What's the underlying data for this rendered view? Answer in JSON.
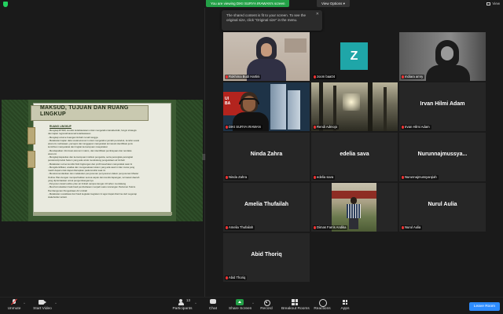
{
  "banner": {
    "viewing": "You are viewing DIKI SURYA IRAWAN's screen",
    "view_options": "View Options ▾",
    "view": "View"
  },
  "tooltip": {
    "text": "The shared content is fit to your screen. To see the original size, click \"Original size\" in the menu.",
    "close": "✕"
  },
  "slide": {
    "title": "MAKSUD, TUJUAN DAN RUANG LINGKUP",
    "subtitle": "RUANG LINGKUP",
    "lines": [
      "- Mengkaji RTRW, kondisi kota/kawasan untuk mengetahui karakteristik, fungsi strategis",
      "  dan kajian regional/nasional kota/kawasan",
      "- Mengkaji volume buangan limbah rumah tangga",
      "- Melakukan kajian data sosial-ekonomi untuk mengetahui jumlah penduduk, kondisi sosial",
      "  ekonomi, kebiasaan, persepsi dan tanggapan masyarakat termasuk  identifikasi  jenis",
      "  kontribusi  masyarakat dan tingkat kemampuan masyarakat",
      "- Mendapatkan informasi ekonomi makro, dan identifikasi pembiayaan dan tendaka",
      "  ekonomi",
      "- Mengkaji kapasitas dan kemampuan institusi pengelola, serta perangkat-perangkat",
      "  peraturan/produk hukum yang ada untuk mendukung pengelolaan air limbah",
      "- Melakukan survei kondisi fisik lingkungan dan profil kesehatan masyarakat saat ini",
      "- Mengidentifikasi, analisa dan mengevaluasi sistem yang ada saat ini  dan  mana  yang",
      "  masih  dapat  untuk  dapat  diterapkan  pada  kondisi  saat ini",
      "- Merekomendasikan dan melakukan penyusunan penyusunan dalam penyusunan Master",
      "  Outline Plan dengan memperhatikan semua aspek dan kondisi lapangan, termasuk daerah",
      "  yang diprioritaskan untuk pengembangannya",
      "- Penyusun detail outline plan air limbah sampai dengan  10  tahun mendatang",
      "- Memformulasikan hasil-hasil pembahasan menjadi suatu rancangan Pedoman Teknis",
      "  Pembangunan Pengelolaan Air Limbah",
      "- Melakukan sosialisasi dari hasil kegiatan kegiatan ini agar dapat diterima oleh segenap",
      "  stakeholder terkait."
    ]
  },
  "participants": [
    {
      "name": "Rokhima Budi Hartini",
      "center": "",
      "photo": "rokhima"
    },
    {
      "name": "zoom baa04",
      "center": "",
      "photo": "zoom"
    },
    {
      "name": "mdiara amry",
      "center": "",
      "photo": "mdiara"
    },
    {
      "name": "DIKI SURYA IRAWAN",
      "center": "",
      "photo": "diki"
    },
    {
      "name": "Rendi Admojo",
      "center": "",
      "photo": "rendi"
    },
    {
      "name": "Irvan Hilmi Adam",
      "center": "Irvan Hilmi Adam",
      "photo": ""
    },
    {
      "name": "Ninda Zahra",
      "center": "Ninda Zahra",
      "photo": ""
    },
    {
      "name": "edelia sava",
      "center": "edelia sava",
      "photo": ""
    },
    {
      "name": "Nurunnajmussyarqiah",
      "center": "Nurunnajmussya...",
      "photo": ""
    },
    {
      "name": "Amelia Thufailah",
      "center": "Amelia Thufailah",
      "photo": ""
    },
    {
      "name": "Dimas Farris Andika",
      "center": "",
      "photo": "dimas"
    },
    {
      "name": "Nurul Aulia",
      "center": "Nurul Aulia",
      "photo": ""
    },
    {
      "name": "Abid Thoriq",
      "center": "Abid Thoriq",
      "photo": ""
    }
  ],
  "zoom_avatar_letter": "Z",
  "diki_bg_text": "UI\nBA",
  "toolbar": {
    "unmute": "Unmute",
    "start_video": "Start Video",
    "participants": "Participants",
    "participants_count": "13",
    "chat": "Chat",
    "share_screen": "Share Screen",
    "record": "Record",
    "breakout_rooms": "Breakout Rooms",
    "reactions": "Reactions",
    "apps": "Apps",
    "leave": "Leave Room",
    "caret": "^"
  },
  "colors": {
    "banner_green": "#23a047",
    "leave_blue": "#2d8cff",
    "active_speaker": "#e6e645",
    "zoom_avatar": "#1fa6a8"
  }
}
